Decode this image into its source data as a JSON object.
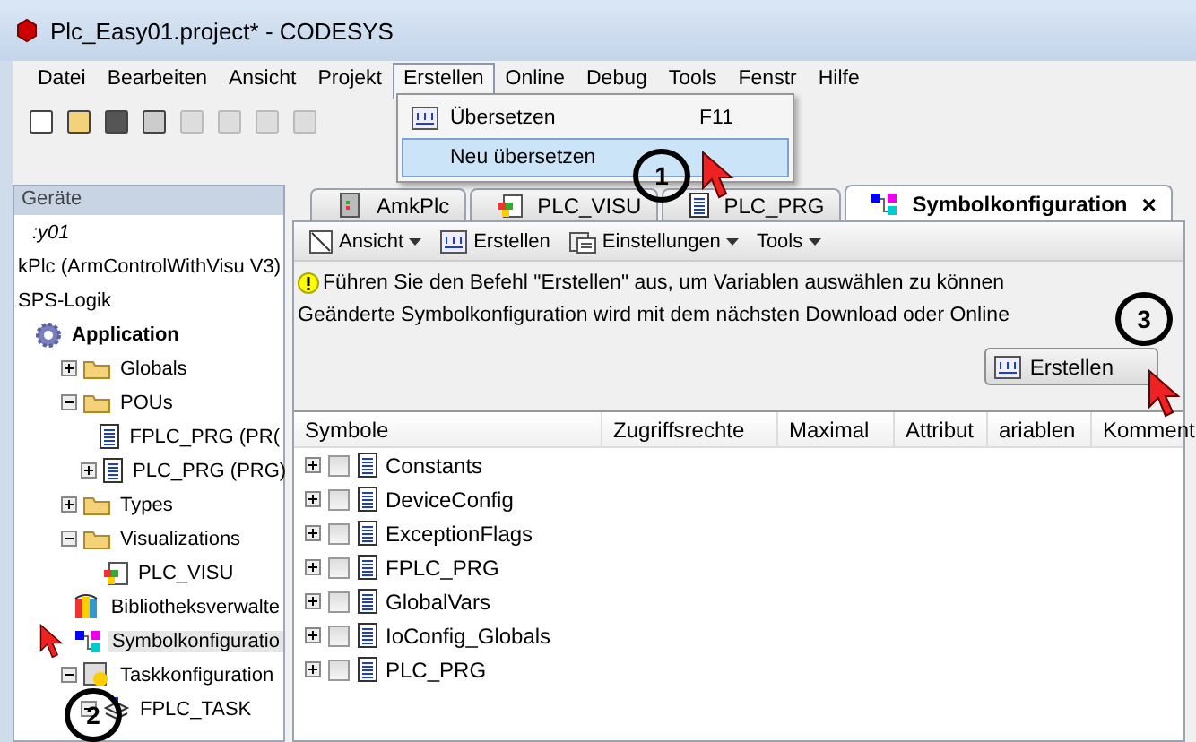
{
  "window": {
    "title": "Plc_Easy01.project* - CODESYS"
  },
  "menu": [
    {
      "label": "Datei",
      "selected": false
    },
    {
      "label": "Bearbeiten",
      "selected": false
    },
    {
      "label": "Ansicht",
      "selected": false
    },
    {
      "label": "Projekt",
      "selected": false
    },
    {
      "label": "Erstellen",
      "selected": true
    },
    {
      "label": "Online",
      "selected": false
    },
    {
      "label": "Debug",
      "selected": false
    },
    {
      "label": "Tools",
      "selected": false
    },
    {
      "label": "Fenstr",
      "selected": false
    },
    {
      "label": "Hilfe",
      "selected": false
    }
  ],
  "dropdown": [
    {
      "label": "Übersetzen",
      "shortcut": "F11",
      "selected": false
    },
    {
      "label": "Neu übersetzen",
      "selected": false,
      "highlighted": true
    }
  ],
  "devices": {
    "title": "Geräte",
    "tree": [
      {
        "label": ":y01",
        "kind": "project"
      },
      {
        "label": "kPlc (ArmControlWithVisu V3)",
        "kind": "plc"
      },
      {
        "label": "SPS-Logik",
        "kind": "logic",
        "children": [
          {
            "label": "Application",
            "kind": "application",
            "selected": false,
            "children": [
              {
                "label": "Globals",
                "kind": "folder",
                "expanded": false,
                "selected": false
              },
              {
                "label": "POUs",
                "kind": "folder",
                "expanded": true,
                "selected": false,
                "children": [
                  {
                    "label": "FPLC_PRG (PR(",
                    "kind": "doc",
                    "selected": false
                  },
                  {
                    "label": "PLC_PRG (PRG)",
                    "kind": "doc",
                    "expanded": false,
                    "selected": false
                  }
                ]
              },
              {
                "label": "Types",
                "kind": "folder",
                "expanded": false,
                "selected": false
              },
              {
                "label": "Visualizations",
                "kind": "folder",
                "expanded": true,
                "selected": false,
                "children": [
                  {
                    "label": "PLC_VISU",
                    "kind": "visu",
                    "selected": false
                  }
                ]
              },
              {
                "label": "Bibliotheksverwalte",
                "kind": "books",
                "selected": false
              },
              {
                "label": "Symbolkonfiguratio",
                "kind": "symbols",
                "selected": true
              },
              {
                "label": "Taskkonfiguration",
                "kind": "task",
                "expanded": true,
                "selected": false,
                "children": [
                  {
                    "label": "FPLC_TASK",
                    "kind": "stack",
                    "expanded": true,
                    "selected": false
                  }
                ]
              }
            ]
          }
        ]
      }
    ]
  },
  "tabs": [
    {
      "label": "AmkPlc",
      "selected": false,
      "kind": "device"
    },
    {
      "label": "PLC_VISU",
      "selected": false,
      "kind": "visu"
    },
    {
      "label": "PLC_PRG",
      "selected": false,
      "kind": "doc"
    },
    {
      "label": "Symbolkonfiguration",
      "selected": true,
      "kind": "symbols",
      "close": "×"
    }
  ],
  "editor_toolbar": [
    {
      "label": "Ansicht",
      "kind": "view",
      "dropdown": true
    },
    {
      "label": "Erstellen",
      "kind": "build",
      "dropdown": false
    },
    {
      "label": "Einstellungen",
      "kind": "settings",
      "dropdown": true
    },
    {
      "label": "Tools",
      "kind": "none",
      "dropdown": true
    }
  ],
  "info": "Führen Sie den Befehl \"Erstellen\" aus, um Variablen auswählen zu können",
  "note": "Geänderte Symbolkonfiguration wird mit dem nächsten Download oder Online",
  "build_button": "Erstellen",
  "table": {
    "columns": [
      "Symbole",
      "Zugriffsrechte",
      "Maximal",
      "Attribut",
      "ariablen",
      "Komment"
    ],
    "rows": [
      {
        "name": "Constants",
        "checked": false
      },
      {
        "name": "DeviceConfig",
        "checked": false
      },
      {
        "name": "ExceptionFlags",
        "checked": false
      },
      {
        "name": "FPLC_PRG",
        "checked": false
      },
      {
        "name": "GlobalVars",
        "checked": false
      },
      {
        "name": "IoConfig_Globals",
        "checked": false
      },
      {
        "name": "PLC_PRG",
        "checked": false
      }
    ]
  },
  "annotations": [
    "1",
    "2",
    "3"
  ]
}
